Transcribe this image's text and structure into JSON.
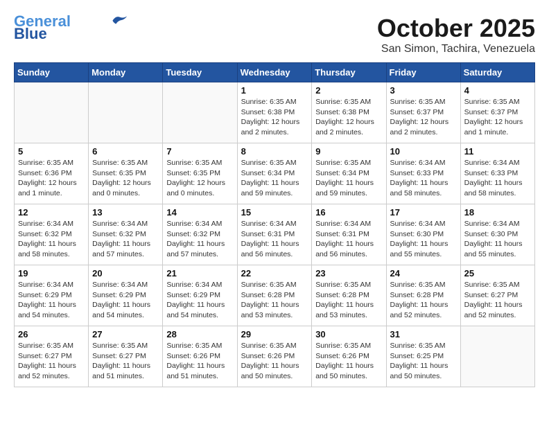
{
  "header": {
    "logo_line1": "General",
    "logo_line2": "Blue",
    "month": "October 2025",
    "location": "San Simon, Tachira, Venezuela"
  },
  "weekdays": [
    "Sunday",
    "Monday",
    "Tuesday",
    "Wednesday",
    "Thursday",
    "Friday",
    "Saturday"
  ],
  "weeks": [
    [
      {
        "day": "",
        "info": ""
      },
      {
        "day": "",
        "info": ""
      },
      {
        "day": "",
        "info": ""
      },
      {
        "day": "1",
        "info": "Sunrise: 6:35 AM\nSunset: 6:38 PM\nDaylight: 12 hours\nand 2 minutes."
      },
      {
        "day": "2",
        "info": "Sunrise: 6:35 AM\nSunset: 6:38 PM\nDaylight: 12 hours\nand 2 minutes."
      },
      {
        "day": "3",
        "info": "Sunrise: 6:35 AM\nSunset: 6:37 PM\nDaylight: 12 hours\nand 2 minutes."
      },
      {
        "day": "4",
        "info": "Sunrise: 6:35 AM\nSunset: 6:37 PM\nDaylight: 12 hours\nand 1 minute."
      }
    ],
    [
      {
        "day": "5",
        "info": "Sunrise: 6:35 AM\nSunset: 6:36 PM\nDaylight: 12 hours\nand 1 minute."
      },
      {
        "day": "6",
        "info": "Sunrise: 6:35 AM\nSunset: 6:35 PM\nDaylight: 12 hours\nand 0 minutes."
      },
      {
        "day": "7",
        "info": "Sunrise: 6:35 AM\nSunset: 6:35 PM\nDaylight: 12 hours\nand 0 minutes."
      },
      {
        "day": "8",
        "info": "Sunrise: 6:35 AM\nSunset: 6:34 PM\nDaylight: 11 hours\nand 59 minutes."
      },
      {
        "day": "9",
        "info": "Sunrise: 6:35 AM\nSunset: 6:34 PM\nDaylight: 11 hours\nand 59 minutes."
      },
      {
        "day": "10",
        "info": "Sunrise: 6:34 AM\nSunset: 6:33 PM\nDaylight: 11 hours\nand 58 minutes."
      },
      {
        "day": "11",
        "info": "Sunrise: 6:34 AM\nSunset: 6:33 PM\nDaylight: 11 hours\nand 58 minutes."
      }
    ],
    [
      {
        "day": "12",
        "info": "Sunrise: 6:34 AM\nSunset: 6:32 PM\nDaylight: 11 hours\nand 58 minutes."
      },
      {
        "day": "13",
        "info": "Sunrise: 6:34 AM\nSunset: 6:32 PM\nDaylight: 11 hours\nand 57 minutes."
      },
      {
        "day": "14",
        "info": "Sunrise: 6:34 AM\nSunset: 6:32 PM\nDaylight: 11 hours\nand 57 minutes."
      },
      {
        "day": "15",
        "info": "Sunrise: 6:34 AM\nSunset: 6:31 PM\nDaylight: 11 hours\nand 56 minutes."
      },
      {
        "day": "16",
        "info": "Sunrise: 6:34 AM\nSunset: 6:31 PM\nDaylight: 11 hours\nand 56 minutes."
      },
      {
        "day": "17",
        "info": "Sunrise: 6:34 AM\nSunset: 6:30 PM\nDaylight: 11 hours\nand 55 minutes."
      },
      {
        "day": "18",
        "info": "Sunrise: 6:34 AM\nSunset: 6:30 PM\nDaylight: 11 hours\nand 55 minutes."
      }
    ],
    [
      {
        "day": "19",
        "info": "Sunrise: 6:34 AM\nSunset: 6:29 PM\nDaylight: 11 hours\nand 54 minutes."
      },
      {
        "day": "20",
        "info": "Sunrise: 6:34 AM\nSunset: 6:29 PM\nDaylight: 11 hours\nand 54 minutes."
      },
      {
        "day": "21",
        "info": "Sunrise: 6:34 AM\nSunset: 6:29 PM\nDaylight: 11 hours\nand 54 minutes."
      },
      {
        "day": "22",
        "info": "Sunrise: 6:35 AM\nSunset: 6:28 PM\nDaylight: 11 hours\nand 53 minutes."
      },
      {
        "day": "23",
        "info": "Sunrise: 6:35 AM\nSunset: 6:28 PM\nDaylight: 11 hours\nand 53 minutes."
      },
      {
        "day": "24",
        "info": "Sunrise: 6:35 AM\nSunset: 6:28 PM\nDaylight: 11 hours\nand 52 minutes."
      },
      {
        "day": "25",
        "info": "Sunrise: 6:35 AM\nSunset: 6:27 PM\nDaylight: 11 hours\nand 52 minutes."
      }
    ],
    [
      {
        "day": "26",
        "info": "Sunrise: 6:35 AM\nSunset: 6:27 PM\nDaylight: 11 hours\nand 52 minutes."
      },
      {
        "day": "27",
        "info": "Sunrise: 6:35 AM\nSunset: 6:27 PM\nDaylight: 11 hours\nand 51 minutes."
      },
      {
        "day": "28",
        "info": "Sunrise: 6:35 AM\nSunset: 6:26 PM\nDaylight: 11 hours\nand 51 minutes."
      },
      {
        "day": "29",
        "info": "Sunrise: 6:35 AM\nSunset: 6:26 PM\nDaylight: 11 hours\nand 50 minutes."
      },
      {
        "day": "30",
        "info": "Sunrise: 6:35 AM\nSunset: 6:26 PM\nDaylight: 11 hours\nand 50 minutes."
      },
      {
        "day": "31",
        "info": "Sunrise: 6:35 AM\nSunset: 6:25 PM\nDaylight: 11 hours\nand 50 minutes."
      },
      {
        "day": "",
        "info": ""
      }
    ]
  ]
}
